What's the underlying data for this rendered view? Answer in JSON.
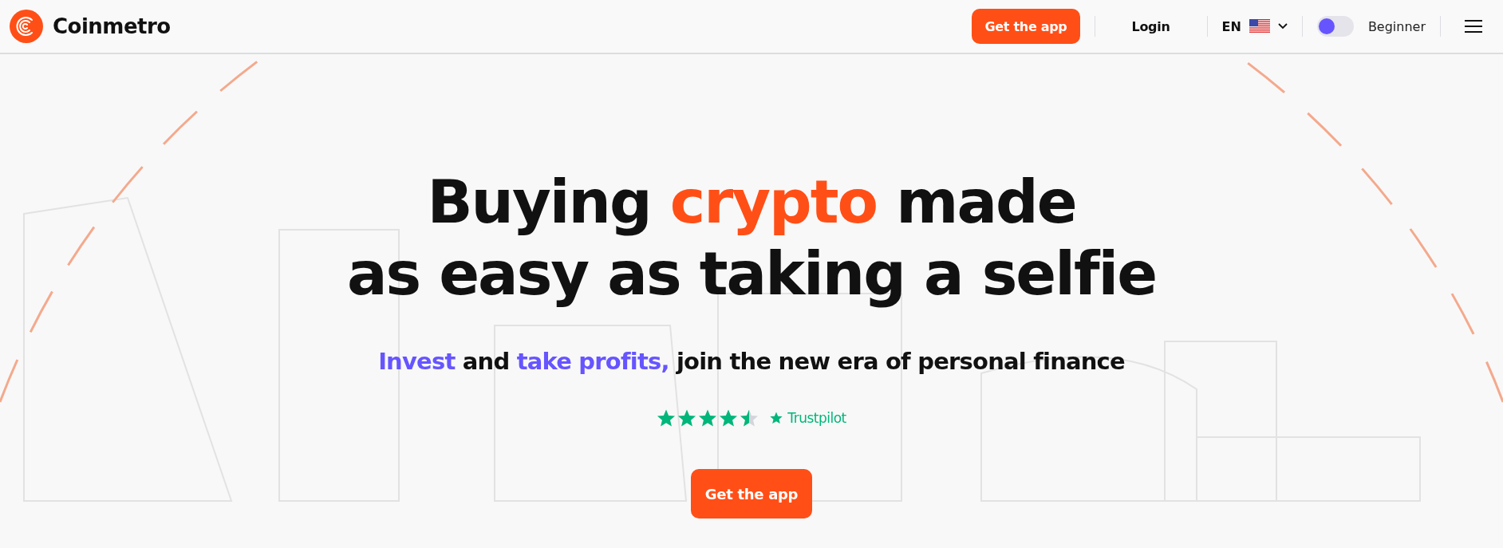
{
  "header": {
    "brand": "Coinmetro",
    "get_app": "Get the app",
    "login": "Login",
    "language": "EN",
    "mode_toggle": {
      "on": false,
      "label": "Beginner"
    }
  },
  "hero": {
    "title_lines": [
      [
        {
          "text": "Buying ",
          "accent": false
        },
        {
          "text": "crypto",
          "accent": true
        },
        {
          "text": " made",
          "accent": false
        }
      ],
      [
        {
          "text": "as easy as taking a selfie",
          "accent": false
        }
      ]
    ],
    "subtitle": [
      {
        "text": "Invest",
        "accent": true
      },
      {
        "text": " and ",
        "accent": false
      },
      {
        "text": "take profits,",
        "accent": true
      },
      {
        "text": " join the new era of personal finance",
        "accent": false
      }
    ],
    "rating": {
      "stars": 4.5,
      "label": "Trustpilot"
    },
    "cta": "Get the app"
  }
}
